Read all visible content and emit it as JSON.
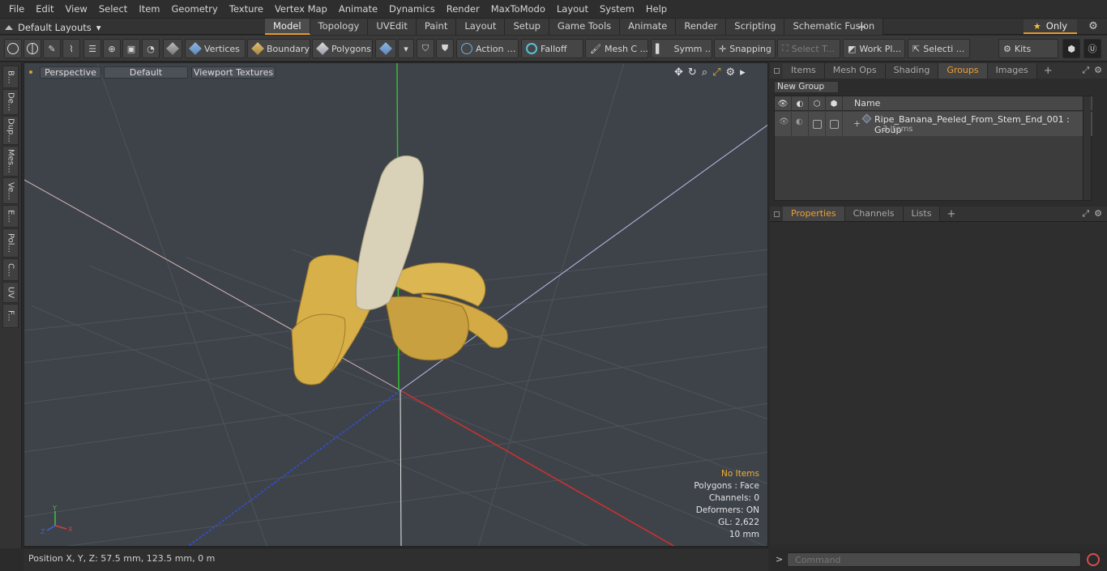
{
  "menu": [
    "File",
    "Edit",
    "View",
    "Select",
    "Item",
    "Geometry",
    "Texture",
    "Vertex Map",
    "Animate",
    "Dynamics",
    "Render",
    "MaxToModo",
    "Layout",
    "System",
    "Help"
  ],
  "modebar": {
    "layout_label": "Default Layouts",
    "tabs": [
      "Model",
      "Topology",
      "UVEdit",
      "Paint",
      "Layout",
      "Setup",
      "Game Tools",
      "Animate",
      "Render",
      "Scripting",
      "Schematic Fusion"
    ],
    "active_tab": "Model",
    "only_label": "Only"
  },
  "toolbar": {
    "vertices": "Vertices",
    "boundary": "Boundary",
    "polygons": "Polygons",
    "action": "Action",
    "falloff": "Falloff",
    "mesh_c": "Mesh C ...",
    "symm": "Symm ...",
    "snapping": "Snapping",
    "select_t": "Select T...",
    "work_pl": "Work Pl...",
    "selecti": "Selecti ...",
    "kits": "Kits"
  },
  "left_tabs": [
    "B...",
    "De...",
    "Dup...",
    "Mes...",
    "Ve...",
    "E...",
    "Pol...",
    "C...",
    "UV",
    "F..."
  ],
  "viewport": {
    "view_mode": "Perspective",
    "shading": "Default",
    "textures": "Viewport Textures",
    "info": {
      "selection": "No Items",
      "polygons": "Polygons : Face",
      "channels": "Channels: 0",
      "deformers": "Deformers: ON",
      "gl": "GL: 2,622",
      "scale": "10 mm"
    },
    "gizmo": {
      "x": "X",
      "y": "Y",
      "z": "Z"
    }
  },
  "status": {
    "position": "Position X, Y, Z:   57.5 mm, 123.5 mm, 0 m"
  },
  "panel_top": {
    "tabs": [
      "Items",
      "Mesh Ops",
      "Shading",
      "Groups",
      "Images"
    ],
    "active": "Groups",
    "new_group": "New Group",
    "col_name": "Name",
    "group": {
      "name": "Ripe_Banana_Peeled_From_Stem_End_001 : Group",
      "items": "3 Items"
    }
  },
  "panel_bottom": {
    "tabs": [
      "Properties",
      "Channels",
      "Lists"
    ],
    "active": "Properties"
  },
  "command": {
    "placeholder": "Command",
    "prompt": ">"
  },
  "colors": {
    "accent": "#e09a2b",
    "viewport_bg": "#3e434a",
    "axis_x": "#d03030",
    "axis_y": "#30c030",
    "axis_z": "#3050e0"
  }
}
